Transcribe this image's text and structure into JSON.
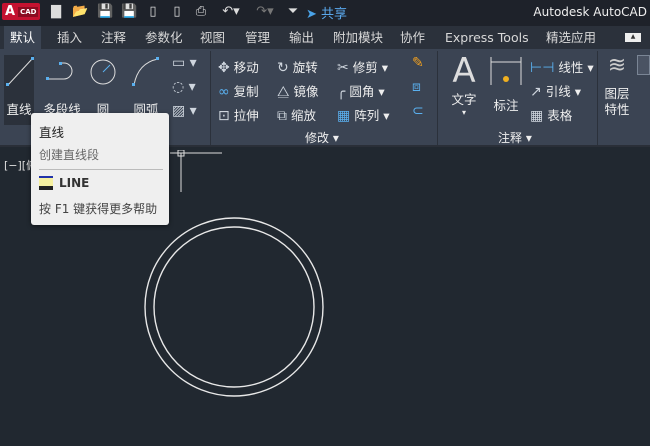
{
  "titlebar": {
    "logo_main": "A",
    "logo_sub": "CAD",
    "share": "共享",
    "app_title": "Autodesk AutoCAD"
  },
  "tabs": [
    "默认",
    "插入",
    "注释",
    "参数化",
    "视图",
    "管理",
    "输出",
    "附加模块",
    "协作",
    "Express Tools",
    "精选应用"
  ],
  "draw": {
    "line": "直线",
    "polyline": "多段线",
    "circle": "圆",
    "arc": "圆弧"
  },
  "modify": {
    "label": "修改",
    "items": [
      "移动",
      "旋转",
      "修剪",
      "复制",
      "镜像",
      "圆角",
      "拉伸",
      "缩放",
      "阵列"
    ]
  },
  "annotation": {
    "label": "注释",
    "text": "文字",
    "dimension": "标注",
    "linear": "线性",
    "leader": "引线",
    "table": "表格"
  },
  "layers": {
    "properties_line1": "图层",
    "properties_line2": "特性"
  },
  "tooltip": {
    "title": "直线",
    "description": "创建直线段",
    "command": "LINE",
    "help": "按 F1 键获得更多帮助"
  },
  "viewport": {
    "label": "[−][俯"
  }
}
